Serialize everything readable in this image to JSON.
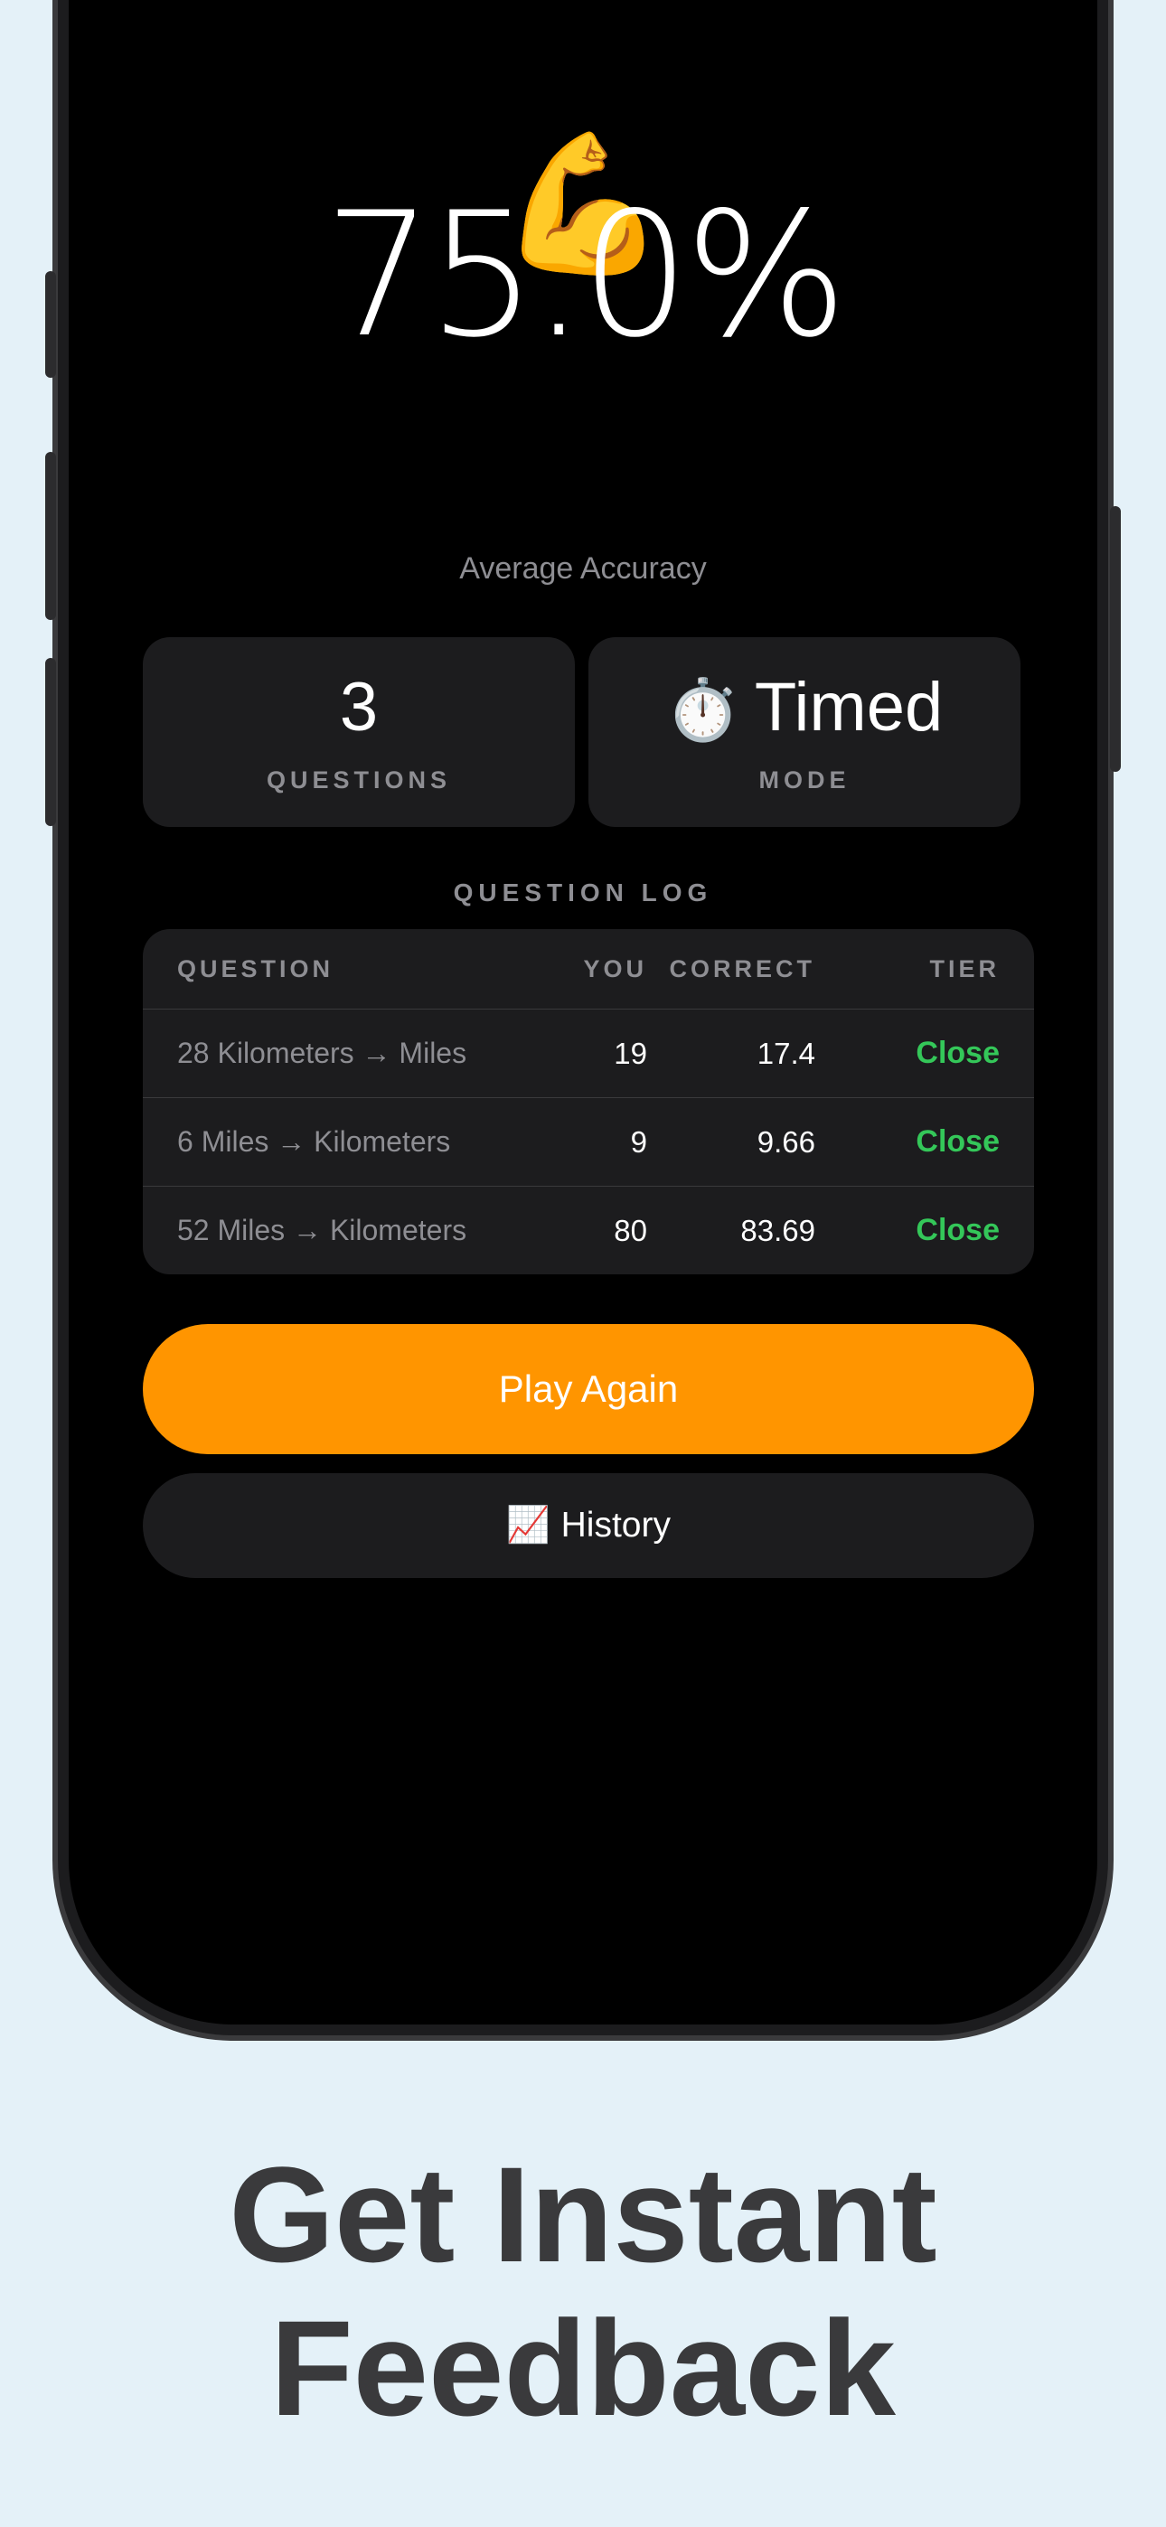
{
  "hero": {
    "emoji": "💪",
    "emoji_icon": "flexed-biceps-icon",
    "accuracy_value": "75.0%",
    "accuracy_label": "Average Accuracy"
  },
  "stats": {
    "questions": {
      "value": "3",
      "label": "QUESTIONS"
    },
    "mode": {
      "emoji": "⏱️",
      "emoji_icon": "stopwatch-icon",
      "value": "Timed",
      "label": "MODE"
    }
  },
  "question_log": {
    "title": "QUESTION LOG",
    "columns": {
      "question": "QUESTION",
      "you": "YOU",
      "correct": "CORRECT",
      "tier": "TIER"
    },
    "rows": [
      {
        "question": "28 Kilometers → Miles",
        "you": "19",
        "correct": "17.4",
        "tier": "Close"
      },
      {
        "question": "6 Miles → Kilometers",
        "you": "9",
        "correct": "9.66",
        "tier": "Close"
      },
      {
        "question": "52 Miles → Kilometers",
        "you": "80",
        "correct": "83.69",
        "tier": "Close"
      }
    ]
  },
  "buttons": {
    "play_again": "Play Again",
    "history_emoji": "📈",
    "history_icon": "chart-increasing-icon",
    "history": "History"
  },
  "caption": {
    "line1": "Get Instant",
    "line2": "Feedback"
  },
  "colors": {
    "accent_orange": "#ff9500",
    "tier_green": "#34c759",
    "card_background": "#1c1c1e",
    "page_background": "#e4f1f8",
    "caption_text": "#3a3a3c"
  }
}
